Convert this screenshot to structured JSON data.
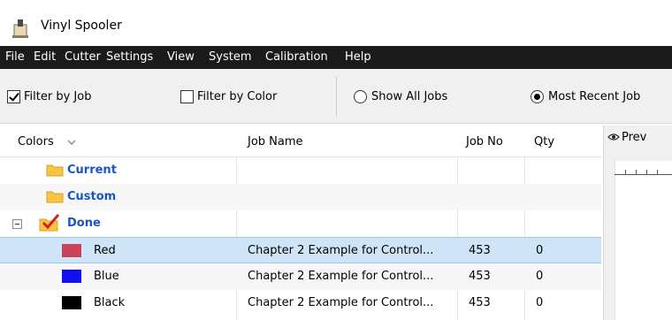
{
  "window": {
    "title": "Vinyl Spooler",
    "icon": "spooler-app-icon"
  },
  "menu": [
    "File",
    "Edit",
    "Cutter",
    "Settings",
    "View",
    "System",
    "Calibration",
    "Help"
  ],
  "toolbar": {
    "filter_by_job": {
      "label": "Filter by Job",
      "checked": true
    },
    "filter_by_color": {
      "label": "Filter by Color",
      "checked": false
    },
    "show_all_jobs": {
      "label": "Show All Jobs",
      "selected": false
    },
    "most_recent_job": {
      "label": "Most Recent Job",
      "selected": true
    }
  },
  "grid": {
    "columns": [
      "Colors",
      "Job Name",
      "Job No",
      "Qty"
    ],
    "groups": [
      {
        "label": "Current",
        "icon": "folder-icon"
      },
      {
        "label": "Custom",
        "icon": "folder-icon"
      },
      {
        "label": "Done",
        "icon": "checked-folder-icon",
        "expanded": true
      }
    ],
    "rows": [
      {
        "color_name": "Red",
        "swatch": "#c8435a",
        "job_name": "Chapter 2 Example for Control...",
        "job_no": "453",
        "qty": "0",
        "selected": true
      },
      {
        "color_name": "Blue",
        "swatch": "#1010ee",
        "job_name": "Chapter 2 Example for Control...",
        "job_no": "453",
        "qty": "0",
        "selected": false
      },
      {
        "color_name": "Black",
        "swatch": "#000000",
        "job_name": "Chapter 2 Example for Control...",
        "job_no": "453",
        "qty": "0",
        "selected": false
      }
    ]
  },
  "preview": {
    "tab_label": "Prev",
    "icon": "eye-icon"
  }
}
